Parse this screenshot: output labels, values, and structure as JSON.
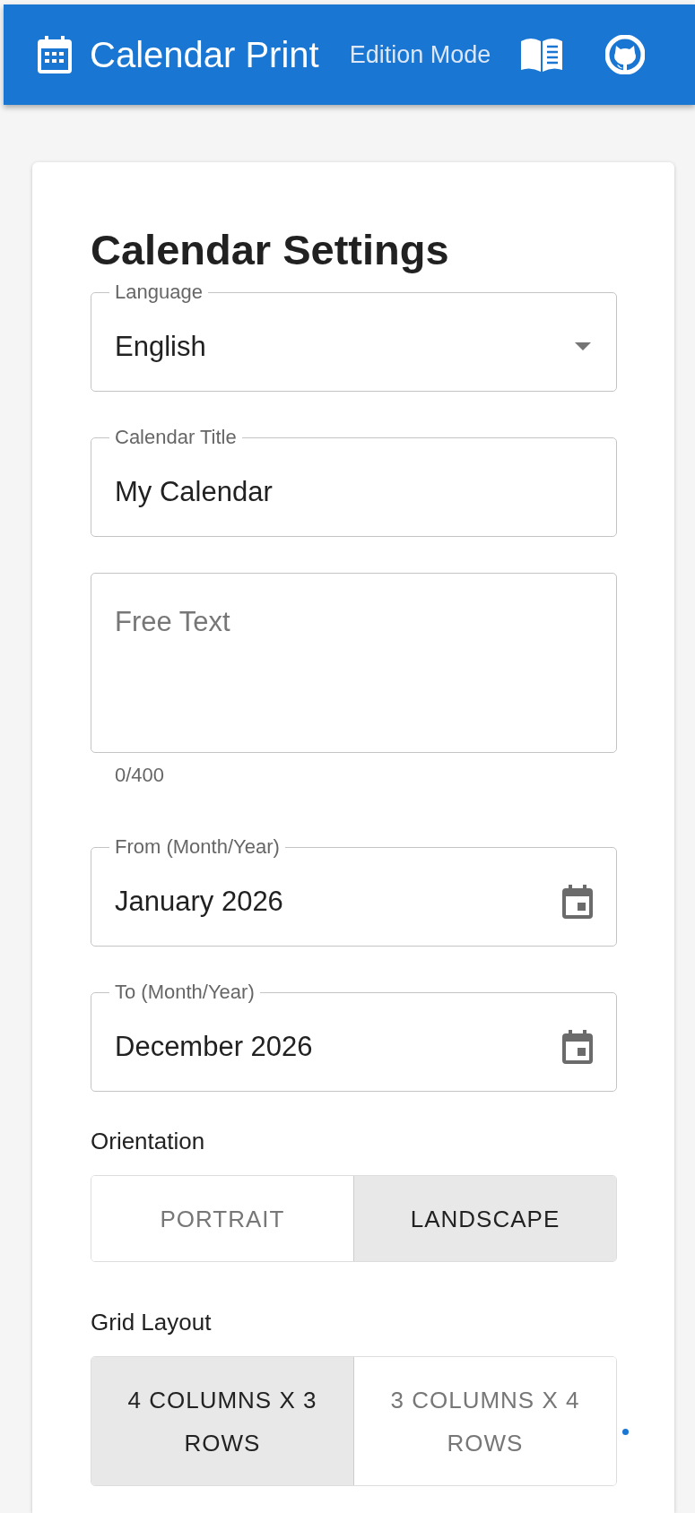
{
  "header": {
    "title": "Calendar Print",
    "mode": "Edition Mode"
  },
  "settings": {
    "heading": "Calendar Settings",
    "fields": [
      {
        "kind": "select",
        "label": "Language",
        "value": "English"
      },
      {
        "kind": "text",
        "label": "Calendar Title",
        "value": "My Calendar"
      },
      {
        "kind": "textarea",
        "placeholder": "Free Text",
        "counter": "0/400"
      },
      {
        "kind": "month",
        "label": "From (Month/Year)",
        "value": "January 2026"
      },
      {
        "kind": "month",
        "label": "To (Month/Year)",
        "value": "December 2026"
      }
    ],
    "toggles": [
      {
        "label": "Orientation",
        "options": [
          {
            "label": "PORTRAIT",
            "selected": false
          },
          {
            "label": "LANDSCAPE",
            "selected": true
          }
        ]
      },
      {
        "label": "Grid Layout",
        "options": [
          {
            "label": "4 COLUMNS X 3 ROWS",
            "selected": true
          },
          {
            "label": "3 COLUMNS X 4 ROWS",
            "selected": false
          }
        ]
      }
    ]
  }
}
